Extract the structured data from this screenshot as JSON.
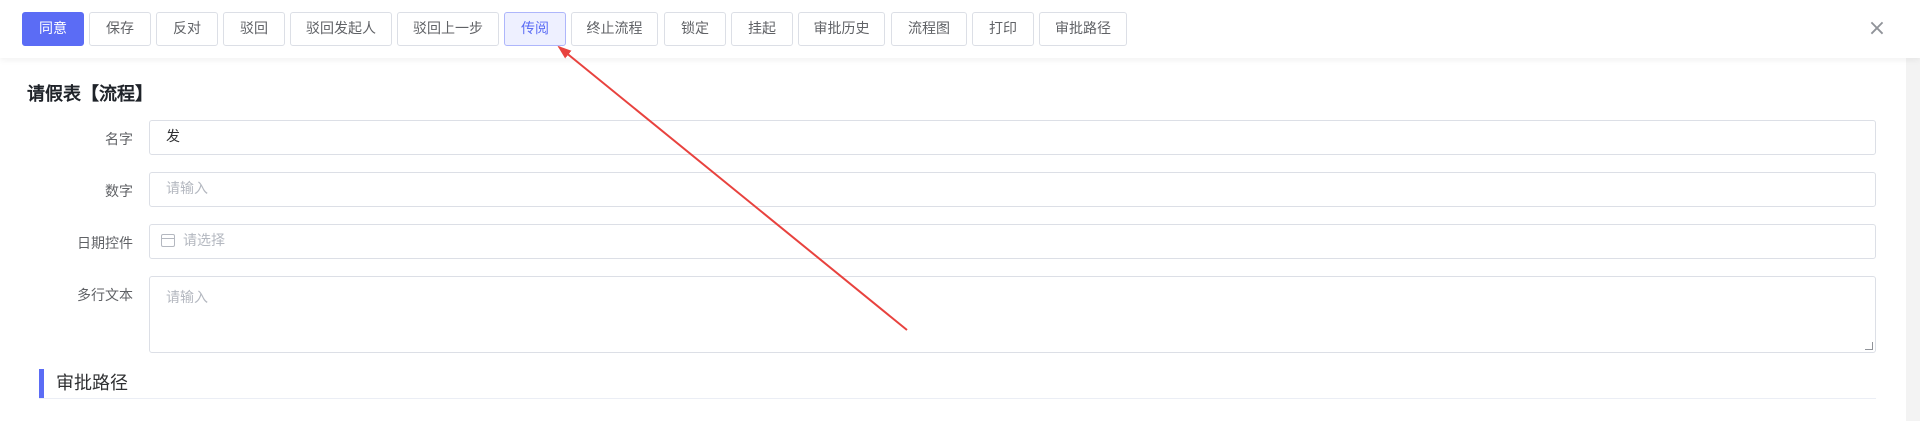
{
  "toolbar": {
    "buttons": [
      "同意",
      "保存",
      "反对",
      "驳回",
      "驳回发起人",
      "驳回上一步",
      "传阅",
      "终止流程",
      "锁定",
      "挂起",
      "审批历史",
      "流程图",
      "打印",
      "审批路径"
    ],
    "close_icon": "close-icon",
    "primary_color": "#5b6cf5"
  },
  "form": {
    "title": "请假表【流程】",
    "fields": [
      {
        "label": "名字",
        "value": "发"
      },
      {
        "label": "数字",
        "placeholder": "请输入"
      },
      {
        "label": "日期控件",
        "placeholder": "请选择",
        "icon": "calendar-icon"
      },
      {
        "label": "多行文本",
        "placeholder": "请输入"
      }
    ]
  },
  "section": {
    "title": "审批路径"
  },
  "annotation": {
    "type": "arrow",
    "color": "#e8423e"
  }
}
